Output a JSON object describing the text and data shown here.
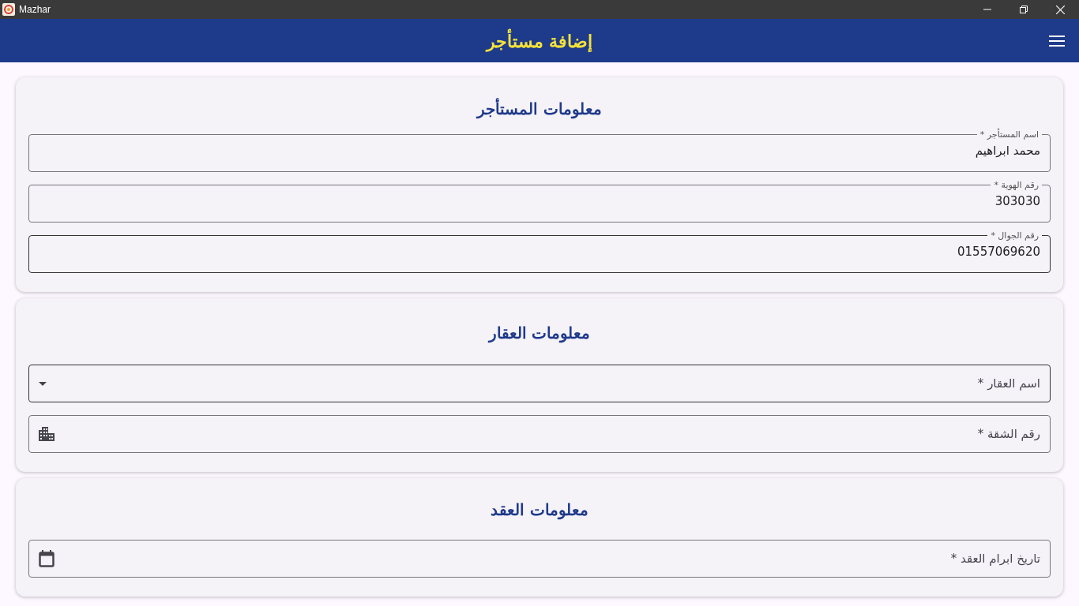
{
  "window": {
    "title": "Mazhar"
  },
  "app_bar": {
    "title": "إضافة مستأجر"
  },
  "sections": [
    {
      "title": "معلومات المستأجر",
      "fields": [
        {
          "kind": "text",
          "label": "اسم المستأجر *",
          "value": "محمد ابراهيم"
        },
        {
          "kind": "text",
          "label": "رقم الهوية *",
          "value": "303030"
        },
        {
          "kind": "text",
          "label": "رقم الجوال *",
          "value": "01557069620"
        }
      ]
    },
    {
      "title": "معلومات العقار",
      "fields": [
        {
          "kind": "dropdown",
          "placeholder": "اسم العقار *"
        },
        {
          "kind": "building",
          "placeholder": "رقم الشقة *"
        }
      ]
    },
    {
      "title": "معلومات العقد",
      "fields": [
        {
          "kind": "date",
          "placeholder": "تاريخ ابرام العقد *"
        }
      ]
    }
  ]
}
